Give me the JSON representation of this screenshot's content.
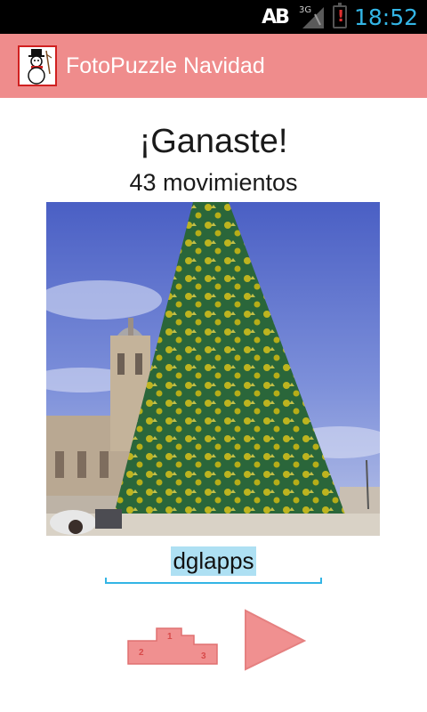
{
  "status_bar": {
    "carrier_icon_text": "AB",
    "network_type": "3G",
    "battery_warning": "!",
    "time": "18:52"
  },
  "action_bar": {
    "app_icon": "snowman-icon",
    "title": "FotoPuzzle Navidad"
  },
  "result": {
    "title": "¡Ganaste!",
    "moves": "43 movimientos"
  },
  "photo": {
    "icon": "christmas-tree-photo"
  },
  "name_input": {
    "value": "dglapps"
  },
  "buttons": {
    "podium_icon": "podium-icon",
    "play_icon": "play-icon"
  },
  "colors": {
    "action_bar": "#ef8c8c",
    "accent": "#33b5e5",
    "selection": "#aee0f3"
  }
}
